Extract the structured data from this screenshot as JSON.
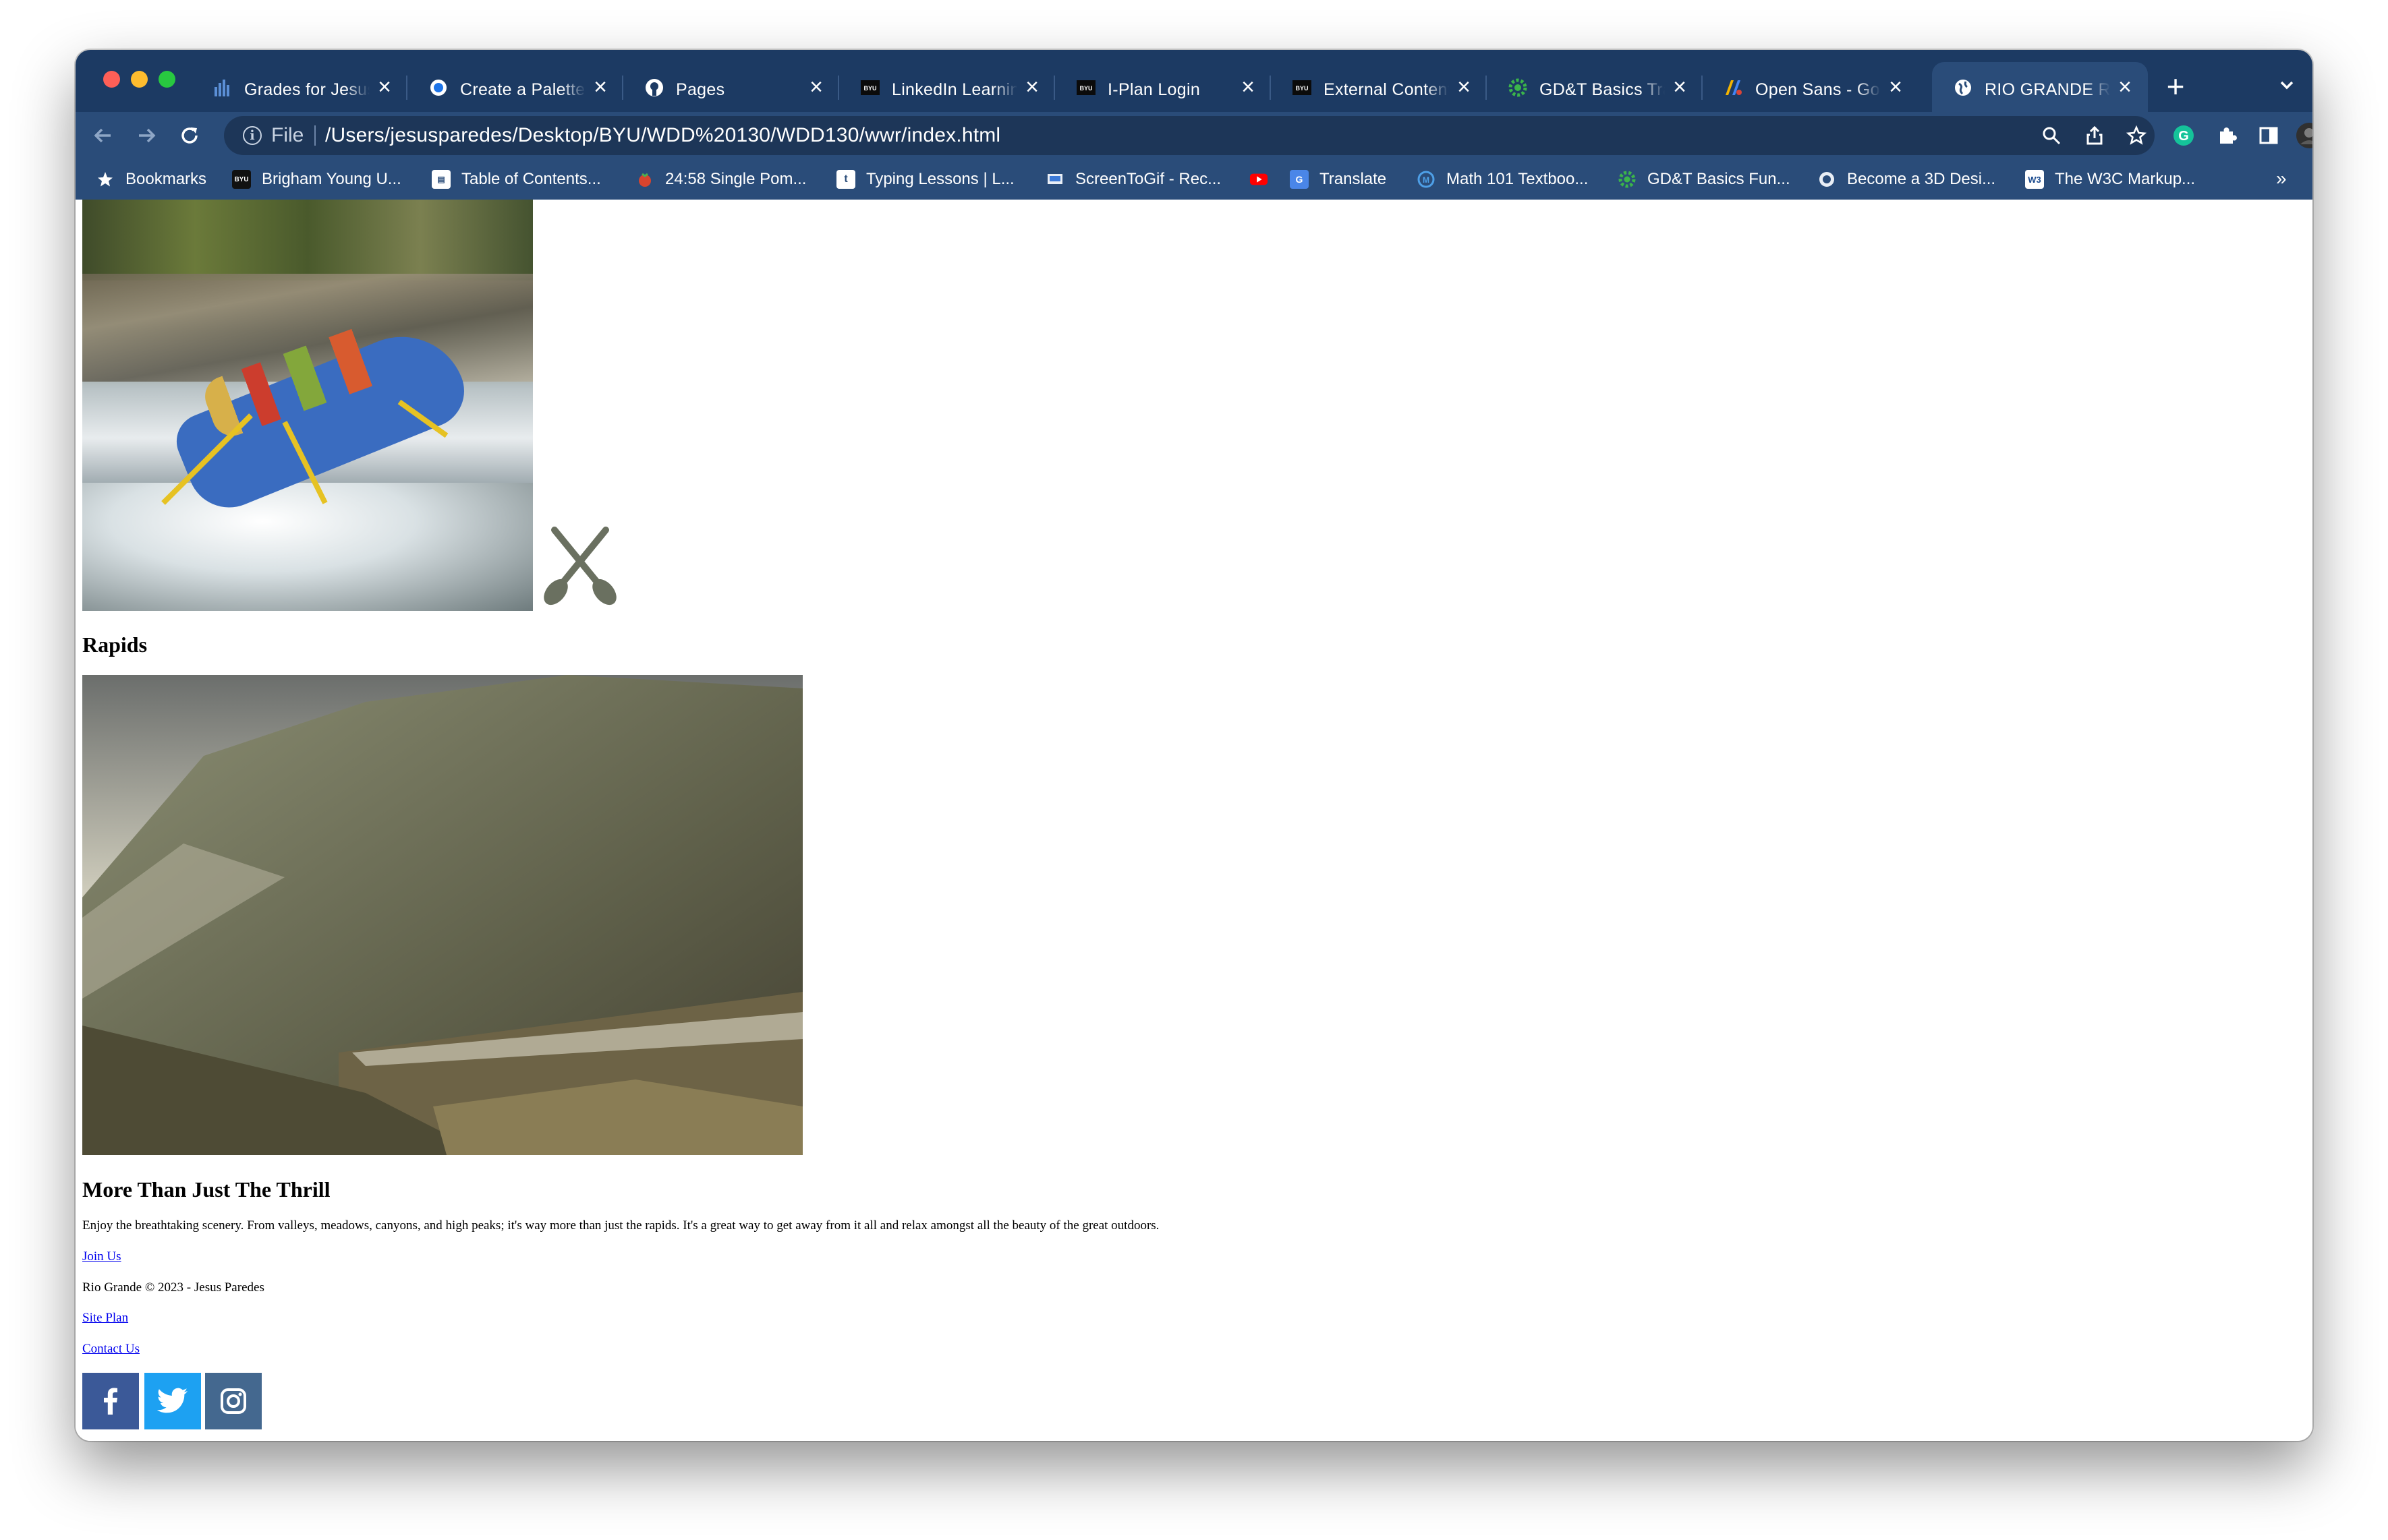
{
  "browser": {
    "tabs": [
      {
        "title": "Grades for Jesus",
        "favicon": "bar-chart-icon",
        "active": false
      },
      {
        "title": "Create a Palette",
        "favicon": "palette-icon",
        "active": false
      },
      {
        "title": "Pages",
        "favicon": "github-icon",
        "active": false
      },
      {
        "title": "LinkedIn Learning",
        "favicon": "byu-icon",
        "active": false
      },
      {
        "title": "I-Plan Login",
        "favicon": "byu-icon",
        "active": false
      },
      {
        "title": "External Content",
        "favicon": "byu-icon",
        "active": false
      },
      {
        "title": "GD&T Basics Training",
        "favicon": "gear-icon",
        "active": false
      },
      {
        "title": "Open Sans - Google Fonts",
        "favicon": "google-fonts-icon",
        "active": false
      },
      {
        "title": "RIO GRANDE RAFTING",
        "favicon": "globe-icon",
        "active": true
      }
    ],
    "omnibox": {
      "scheme_label": "File",
      "url": "/Users/jesusparedes/Desktop/BYU/WDD%20130/WDD130/wwr/index.html"
    },
    "bookmarks": [
      {
        "label": "Bookmarks",
        "icon": "star-icon"
      },
      {
        "label": "Brigham Young U...",
        "icon": "byu-icon"
      },
      {
        "label": "Table of Contents...",
        "icon": "book-icon"
      },
      {
        "label": "24:58 Single Pom...",
        "icon": "tomato-icon"
      },
      {
        "label": "Typing Lessons | L...",
        "icon": "typing-icon"
      },
      {
        "label": "ScreenToGif - Rec...",
        "icon": "screentogif-icon"
      },
      {
        "label": "",
        "icon": "youtube-icon"
      },
      {
        "label": "Translate",
        "icon": "translate-icon"
      },
      {
        "label": "Math 101 Textboo...",
        "icon": "textbook-icon"
      },
      {
        "label": "GD&T Basics Fun...",
        "icon": "gear-icon"
      },
      {
        "label": "Become a 3D Desi...",
        "icon": "design-icon"
      },
      {
        "label": "The W3C Markup...",
        "icon": "w3c-icon"
      }
    ],
    "bookmarks_more": "»",
    "colors": {
      "chrome": "#2a4c79",
      "tabstrip": "#1c3a63"
    }
  },
  "page": {
    "rapids_heading": "Rapids",
    "thrill_heading": "More Than Just The Thrill",
    "thrill_body": "Enjoy the breathtaking scenery. From valleys, meadows, canyons, and high peaks; it's way more than just the rapids. It's a great way to get away from it all and relax amongst all the beauty of the great outdoors.",
    "join_link": "Join Us",
    "copyright": "Rio Grande © 2023 - Jesus Paredes",
    "site_plan_link": "Site Plan",
    "contact_link": "Contact Us",
    "social": [
      {
        "icon": "facebook-icon",
        "color": "#3b5998"
      },
      {
        "icon": "twitter-icon",
        "color": "#1da1f2"
      },
      {
        "icon": "instagram-icon",
        "color": "#44688f"
      }
    ]
  }
}
